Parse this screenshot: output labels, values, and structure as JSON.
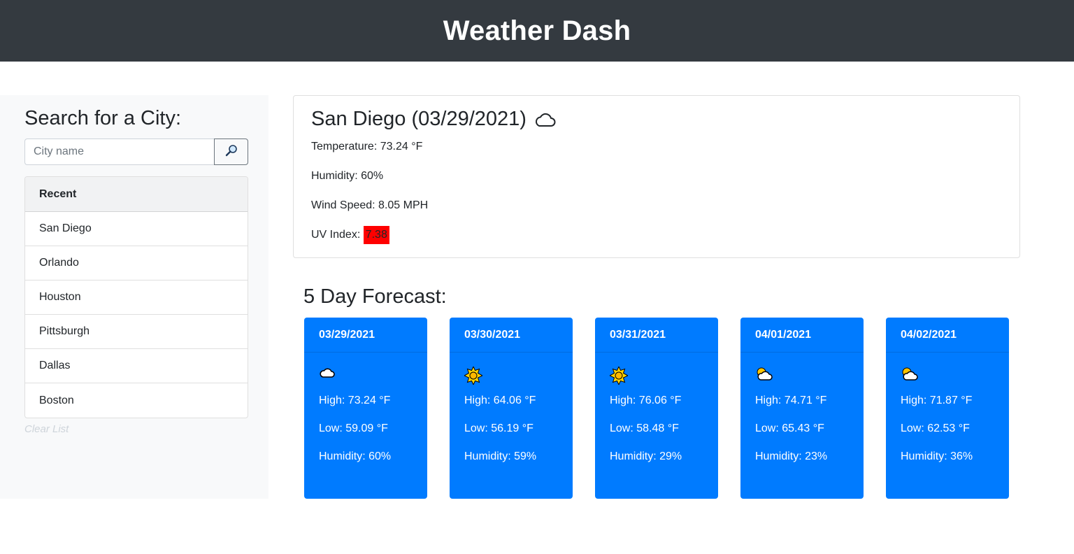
{
  "header": {
    "title": "Weather Dash"
  },
  "search": {
    "heading": "Search for a City:",
    "placeholder": "City name",
    "button_icon": "search-icon"
  },
  "recent": {
    "header": "Recent",
    "items": [
      "San Diego",
      "Orlando",
      "Houston",
      "Pittsburgh",
      "Dallas",
      "Boston"
    ],
    "clear_label": "Clear List"
  },
  "current": {
    "title": "San Diego (03/29/2021)",
    "icon": "cloud-icon",
    "temperature": "Temperature: 73.24 °F",
    "humidity": "Humidity: 60%",
    "wind": "Wind Speed: 8.05 MPH",
    "uv_label": "UV Index: ",
    "uv_value": "7.38",
    "uv_color": "#ff0000"
  },
  "forecast": {
    "heading": "5 Day Forecast:",
    "card_color": "#007bff",
    "days": [
      {
        "date": "03/29/2021",
        "icon": "cloud-icon",
        "high": "High: 73.24 °F",
        "low": "Low: 59.09 °F",
        "humidity": "Humidity: 60%"
      },
      {
        "date": "03/30/2021",
        "icon": "sun-icon",
        "high": "High: 64.06 °F",
        "low": "Low: 56.19 °F",
        "humidity": "Humidity: 59%"
      },
      {
        "date": "03/31/2021",
        "icon": "sun-icon",
        "high": "High: 76.06 °F",
        "low": "Low: 58.48 °F",
        "humidity": "Humidity: 29%"
      },
      {
        "date": "04/01/2021",
        "icon": "partly-cloudy-icon",
        "high": "High: 74.71 °F",
        "low": "Low: 65.43 °F",
        "humidity": "Humidity: 23%"
      },
      {
        "date": "04/02/2021",
        "icon": "partly-cloudy-icon",
        "high": "High: 71.87 °F",
        "low": "Low: 62.53 °F",
        "humidity": "Humidity: 36%"
      }
    ]
  }
}
